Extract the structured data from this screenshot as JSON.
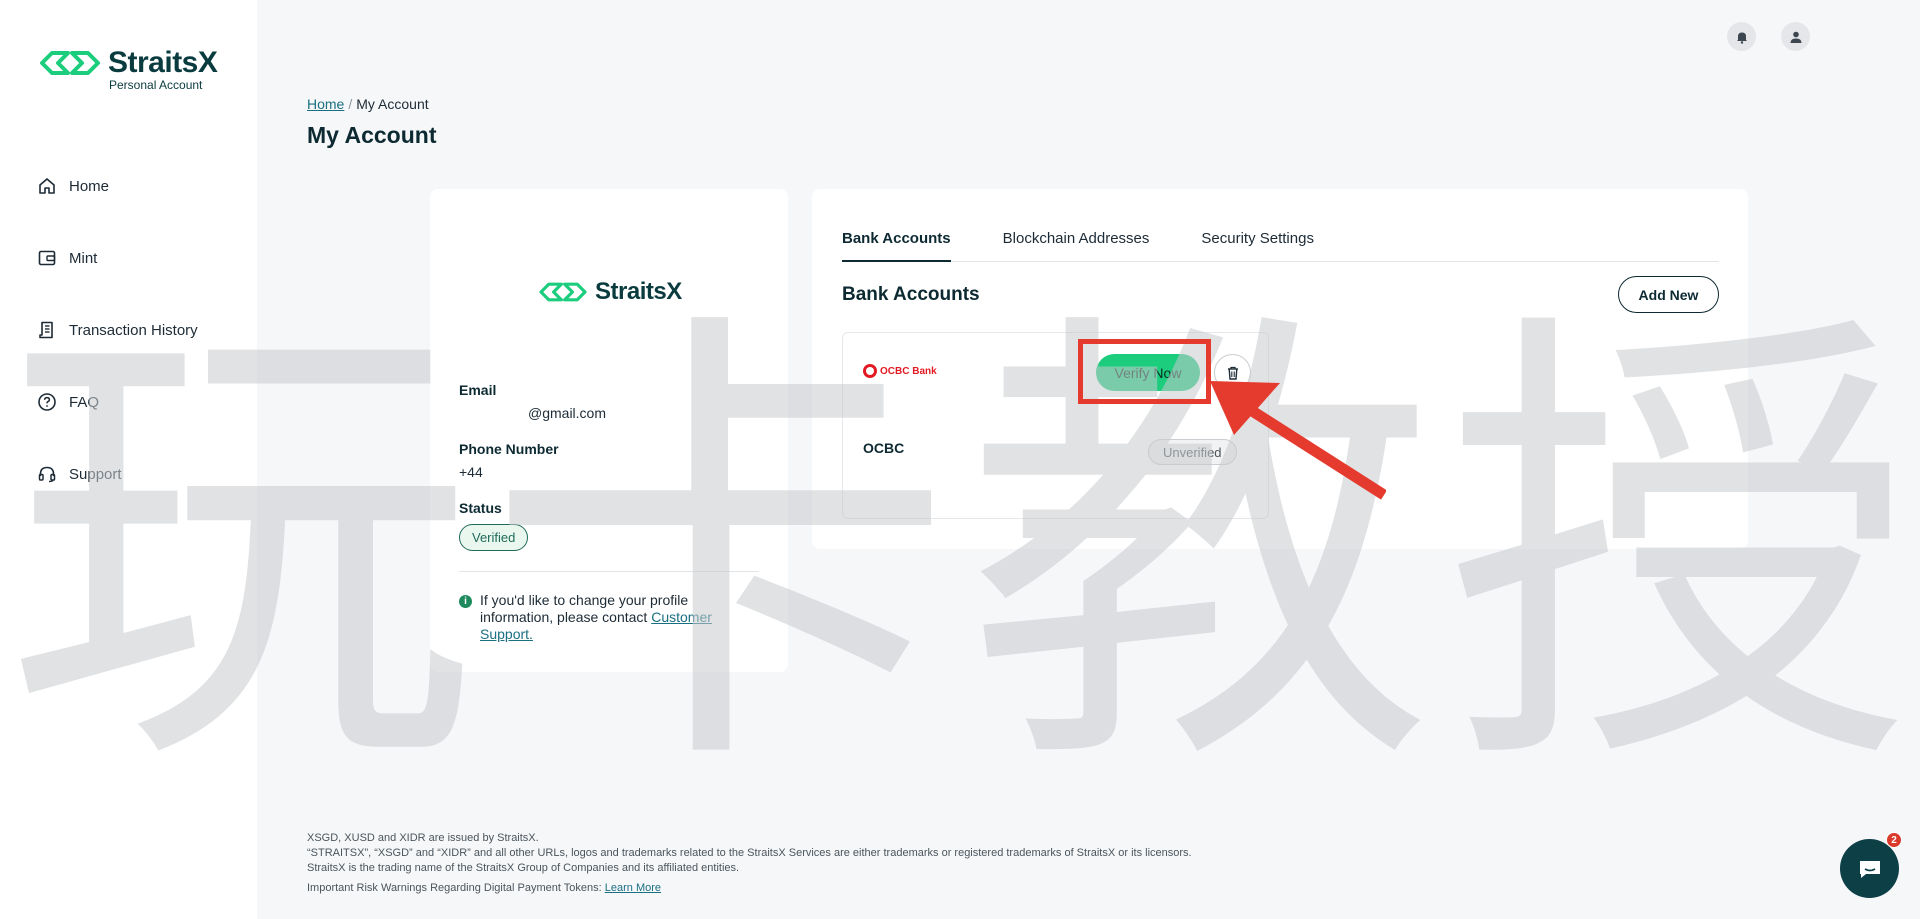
{
  "brand": {
    "name": "StraitsX",
    "subtitle": "Personal Account",
    "color_primary": "#1ccd7d",
    "color_dark": "#0a3b3e"
  },
  "sidebar": {
    "items": [
      {
        "label": "Home",
        "icon": "home-icon"
      },
      {
        "label": "Mint",
        "icon": "wallet-icon"
      },
      {
        "label": "Transaction History",
        "icon": "receipt-icon"
      },
      {
        "label": "FAQ",
        "icon": "question-icon"
      },
      {
        "label": "Support",
        "icon": "headset-icon"
      }
    ]
  },
  "header": {
    "breadcrumb": {
      "home": "Home",
      "sep": "/",
      "current": "My Account"
    },
    "title": "My Account"
  },
  "profile": {
    "email_label": "Email",
    "email_value": "@gmail.com",
    "phone_label": "Phone Number",
    "phone_value": "+44",
    "status_label": "Status",
    "status_value": "Verified",
    "info_text": "If you'd like to change your profile information, please contact ",
    "info_link": "Customer Support."
  },
  "bank": {
    "tabs": [
      {
        "label": "Bank Accounts",
        "active": true
      },
      {
        "label": "Blockchain Addresses",
        "active": false
      },
      {
        "label": "Security Settings",
        "active": false
      }
    ],
    "section_title": "Bank Accounts",
    "add_new_label": "Add New",
    "accounts": [
      {
        "logo_text": "OCBC Bank",
        "name": "OCBC",
        "verify_label": "Verify Now",
        "status": "Unverified"
      }
    ]
  },
  "watermark": {
    "chars": [
      "玩",
      "卡",
      "教",
      "授"
    ]
  },
  "footer": {
    "line1": "XSGD, XUSD and XIDR are issued by StraitsX.",
    "line2": "“STRAITSX”, “XSGD” and “XIDR” and all other URLs, logos and trademarks related to the StraitsX Services are either trademarks or registered trademarks of StraitsX or its licensors.",
    "line3": "StraitsX is the trading name of the StraitsX Group of Companies and its affiliated entities.",
    "line4": "Important Risk Warnings Regarding Digital Payment Tokens: ",
    "link": "Learn More"
  },
  "chat": {
    "badge_count": "2"
  }
}
